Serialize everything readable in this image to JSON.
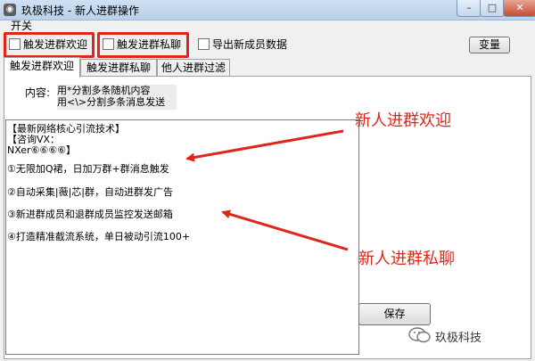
{
  "window": {
    "title": "玖极科技 - 新人进群操作",
    "icon": "app-icon",
    "controls": {
      "minimize": "–",
      "maximize": "□",
      "close": "✕"
    }
  },
  "menu": {
    "kaiguan": "开关"
  },
  "options": {
    "welcome": "触发进群欢迎",
    "private_chat": "触发进群私聊",
    "export_members": "导出新成员数据"
  },
  "buttons": {
    "change": "变量",
    "save": "保存"
  },
  "tabs": [
    "触发进群欢迎",
    "触发进群私聊",
    "他人进群过滤"
  ],
  "content": {
    "label": "内容:",
    "hint_line1": "用*分割多条随机内容",
    "hint_line2": "用<\\>分割多条消息发送"
  },
  "message_lines": [
    "【最新网络核心引流技术】",
    "【咨询VX：",
    "NXer⑥⑥⑥⑥】",
    "①无限加Q裙，日加万群+群消息触发",
    "②自动采集|薇|芯|群，自动进群发广告",
    "③新进群成员和退群成员监控发送邮箱",
    "④打造精准截流系统，单日被动引流100+"
  ],
  "annotations": {
    "welcome": "新人进群欢迎",
    "private_chat": "新人进群私聊"
  },
  "accent_color": "#e0261a",
  "watermark": "玖极科技"
}
